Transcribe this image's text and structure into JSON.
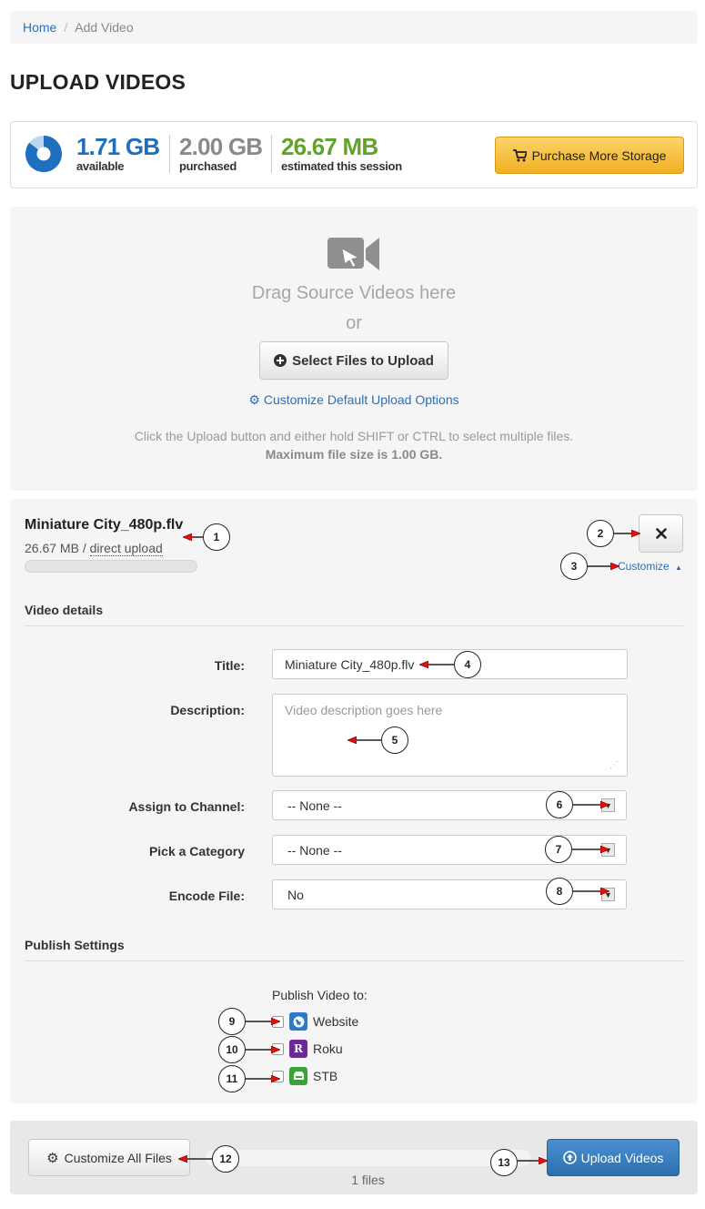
{
  "breadcrumb": {
    "home": "Home",
    "separator": "/",
    "current": "Add Video"
  },
  "page_title": "UPLOAD VIDEOS",
  "storage": {
    "available_value": "1.71 GB",
    "available_label": "available",
    "available_fraction": 0.855,
    "purchased_value": "2.00 GB",
    "purchased_label": "purchased",
    "session_value": "26.67 MB",
    "session_label": "estimated this session",
    "purchase_button": "Purchase More Storage",
    "colors": {
      "available": "#1f6fbf",
      "purchased": "#8a8a8a",
      "session": "#62a32d"
    }
  },
  "dropzone": {
    "icon": "video-camera-cursor-icon",
    "drag_text": "Drag Source Videos here",
    "or_text": "or",
    "select_button": "Select Files to Upload",
    "customize_defaults": "Customize Default Upload Options",
    "help_line": "Click the Upload button and either hold SHIFT or CTRL to select multiple files.",
    "max_size": "Maximum file size is 1.00 GB."
  },
  "file": {
    "name": "Miniature City_480p.flv",
    "size": "26.67 MB",
    "meta_separator": "/",
    "source": "direct upload",
    "progress": 0,
    "remove_icon": "close-icon",
    "customize_link": "Customize"
  },
  "video_details": {
    "heading": "Video details",
    "title_label": "Title:",
    "title_value": "Miniature City_480p.flv",
    "description_label": "Description:",
    "description_placeholder": "Video description goes here",
    "channel_label": "Assign to Channel:",
    "channel_value": "-- None --",
    "category_label": "Pick a Category",
    "category_value": "-- None --",
    "encode_label": "Encode File:",
    "encode_value": "No"
  },
  "publish": {
    "heading": "Publish Settings",
    "publish_to": "Publish Video to:",
    "targets": [
      {
        "label": "Website",
        "icon": "globe-icon",
        "color": "#2a7ac7",
        "checked": false
      },
      {
        "label": "Roku",
        "icon": "roku-icon",
        "glyph": "R",
        "color": "#6a2a9a",
        "checked": false
      },
      {
        "label": "STB",
        "icon": "set-top-box-icon",
        "color": "#3aa33a",
        "checked": false
      }
    ]
  },
  "bottom_bar": {
    "customize_all": "Customize All Files",
    "files_count": "1 files",
    "total_progress": 0,
    "upload_button": "Upload Videos"
  },
  "callouts": [
    "1",
    "2",
    "3",
    "4",
    "5",
    "6",
    "7",
    "8",
    "9",
    "10",
    "11",
    "12",
    "13"
  ]
}
